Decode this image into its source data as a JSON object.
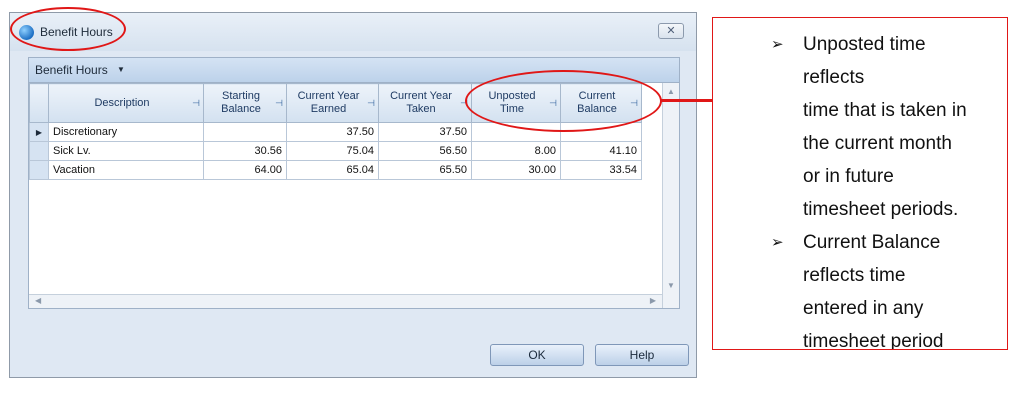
{
  "window": {
    "title": "Benefit Hours",
    "close_glyph": "✕"
  },
  "panel": {
    "title": "Benefit Hours",
    "caret": "▼"
  },
  "grid": {
    "columns": [
      {
        "line1": "Description",
        "line2": ""
      },
      {
        "line1": "Starting",
        "line2": "Balance"
      },
      {
        "line1": "Current Year",
        "line2": "Earned"
      },
      {
        "line1": "Current Year",
        "line2": "Taken"
      },
      {
        "line1": "Unposted",
        "line2": "Time"
      },
      {
        "line1": "Current",
        "line2": "Balance"
      }
    ],
    "pin_glyph": "⊣",
    "current_row_glyph": "▶",
    "rows": [
      {
        "description": "Discretionary",
        "starting_balance": "",
        "earned": "37.50",
        "taken": "37.50",
        "unposted": "",
        "current_balance": ""
      },
      {
        "description": "Sick Lv.",
        "starting_balance": "30.56",
        "earned": "75.04",
        "taken": "56.50",
        "unposted": "8.00",
        "current_balance": "41.10"
      },
      {
        "description": "Vacation",
        "starting_balance": "64.00",
        "earned": "65.04",
        "taken": "65.50",
        "unposted": "30.00",
        "current_balance": "33.54"
      }
    ]
  },
  "buttons": {
    "ok": "OK",
    "help": "Help"
  },
  "callout": {
    "bullet_glyph": "➢",
    "item1": [
      "Unposted time",
      "reflects",
      "time that is taken in",
      "the current month",
      "or in future",
      "timesheet periods."
    ],
    "item2": [
      "Current Balance",
      "reflects time",
      "entered in any",
      "timesheet period"
    ]
  },
  "colors": {
    "highlight": "#e01717",
    "dialog_bg": "#dfe8f3",
    "header_bg": "#d3e1f0"
  }
}
